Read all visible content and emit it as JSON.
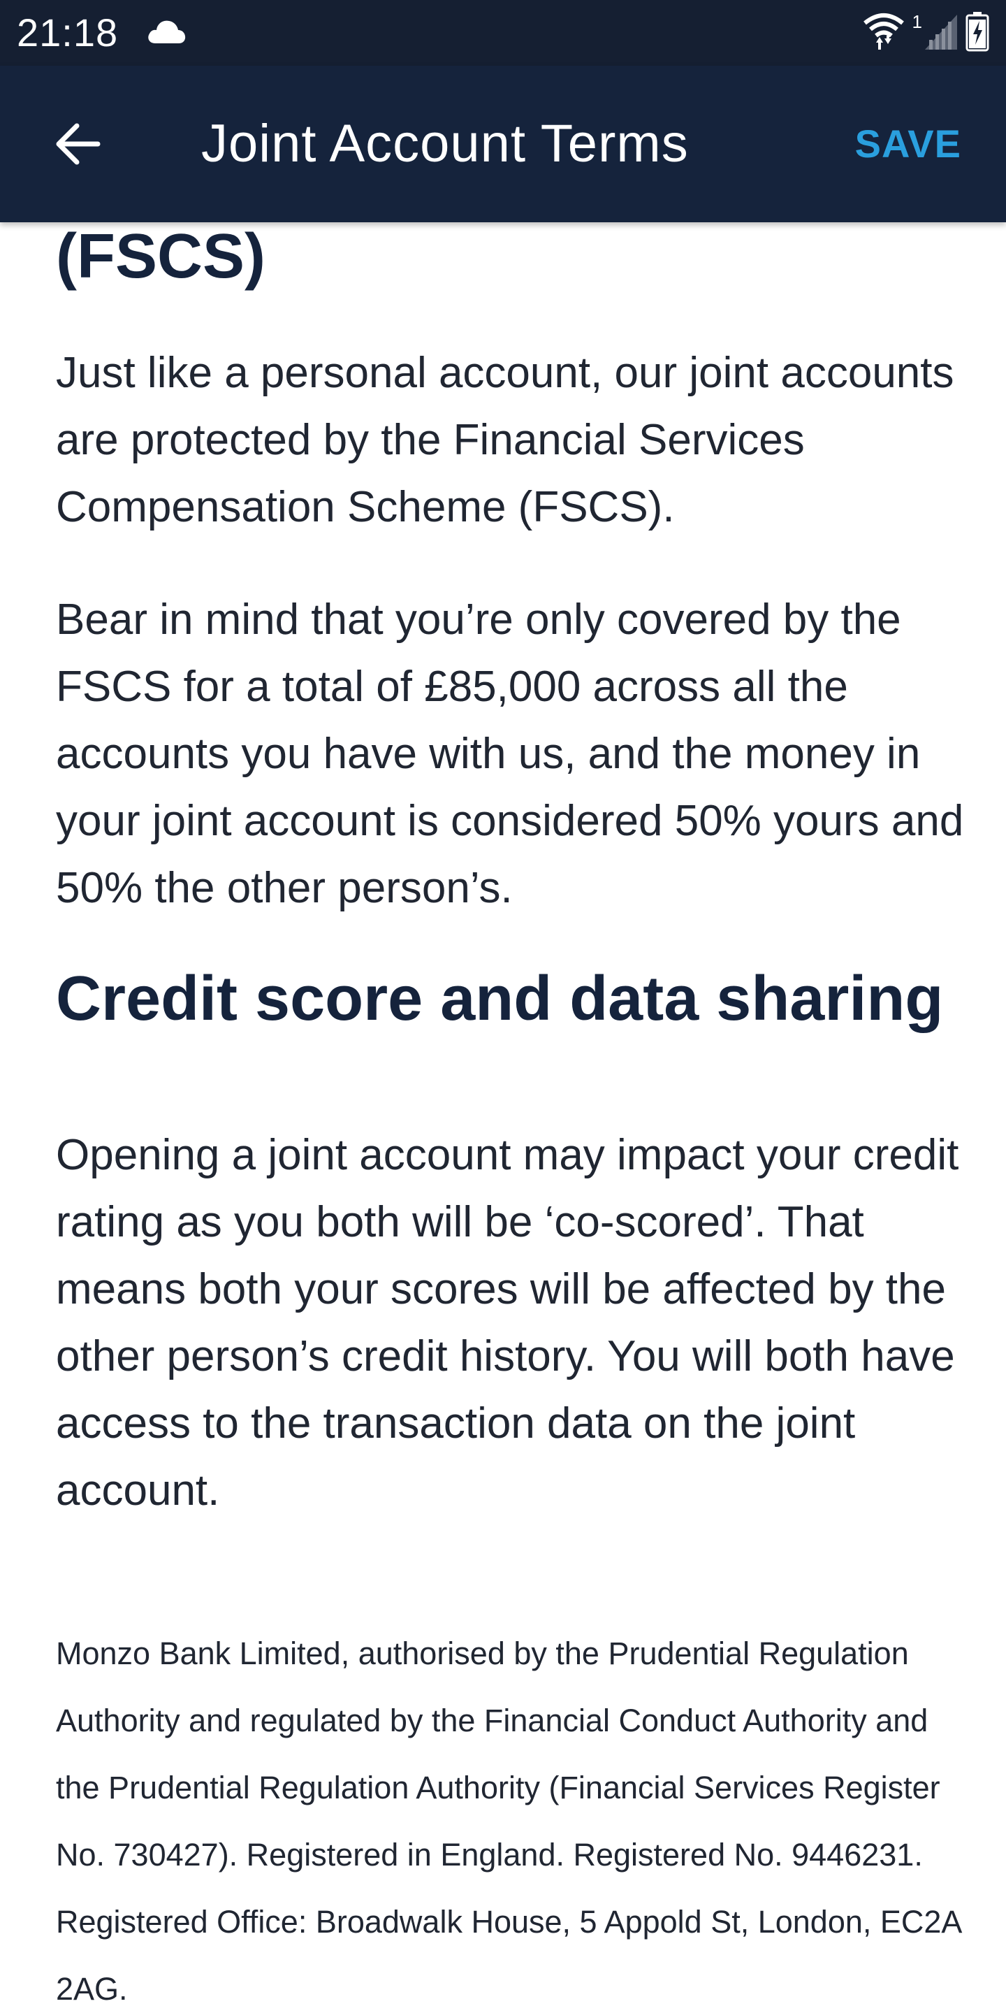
{
  "status_bar": {
    "time": "21:18",
    "network_badge": "1"
  },
  "icons": {
    "cloud": "cloud-icon",
    "wifi": "wifi-icon",
    "signal": "signal-icon",
    "battery": "battery-icon",
    "back": "arrow-left-icon"
  },
  "colors": {
    "header_bg": "#15233c",
    "status_bg": "#151f32",
    "accent": "#2a9fde",
    "heading": "#15233c",
    "body_text": "#202632"
  },
  "app_bar": {
    "title": "Joint Account Terms",
    "save_label": "SAVE"
  },
  "content": {
    "heading_partial": "(FSCS)",
    "paragraph_1": "Just like a personal account, our joint accounts are protected by the Financial Services Compensation Scheme (FSCS).",
    "paragraph_2": "Bear in mind that you’re only covered by the FSCS for a total of £85,000 across all the accounts you have with us, and the money in your joint account is considered 50% yours and 50% the other person’s.",
    "heading_credit": "Credit score and data sharing",
    "paragraph_3": "Opening a joint account may impact your credit rating as you both will be ‘co-scored’. That means both your scores will be affected by the other person’s credit history. You will both have access to the transaction data on the joint account.",
    "footer": "Monzo Bank Limited, authorised by the Prudential Regulation Authority and regulated by the Financial Conduct Authority and the Prudential Regulation Authority (Financial Services Register No. 730427). Registered in England. Registered No. 9446231. Registered Office: Broadwalk House, 5 Appold St, London, EC2A 2AG."
  }
}
